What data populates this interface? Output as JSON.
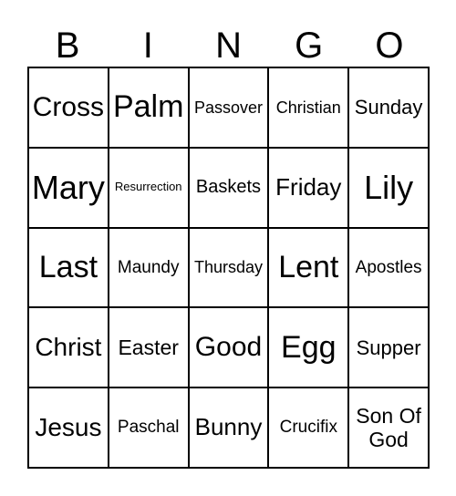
{
  "header": [
    "B",
    "I",
    "N",
    "G",
    "O"
  ],
  "cells": [
    [
      "Cross",
      "Palm",
      "Passover",
      "Christian",
      "Sunday"
    ],
    [
      "Mary",
      "Resurrection",
      "Baskets",
      "Friday",
      "Lily"
    ],
    [
      "Last",
      "Maundy",
      "Thursday",
      "Lent",
      "Apostles"
    ],
    [
      "Christ",
      "Easter",
      "Good",
      "Egg",
      "Supper"
    ],
    [
      "Jesus",
      "Paschal",
      "Bunny",
      "Crucifix",
      "Son Of God"
    ]
  ]
}
